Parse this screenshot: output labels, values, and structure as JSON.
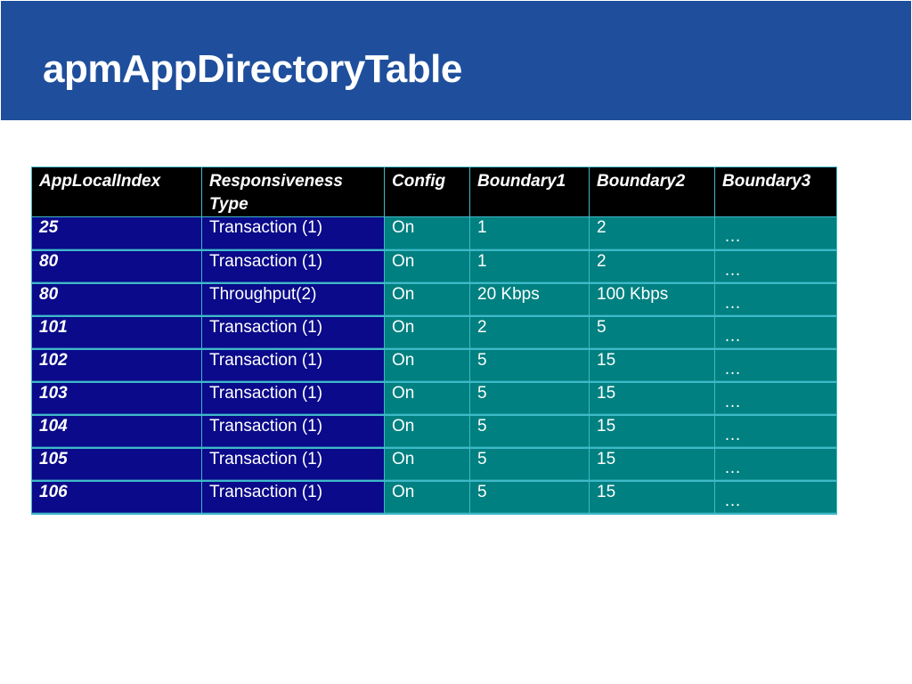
{
  "title": "apmAppDirectoryTable",
  "table": {
    "headers": [
      "AppLocalIndex",
      "Responsiveness Type",
      "Config",
      "Boundary1",
      "Boundary2",
      "Boundary3"
    ],
    "rows": [
      [
        "25",
        "Transaction (1)",
        "On",
        "1",
        "2",
        "…"
      ],
      [
        "80",
        "Transaction (1)",
        "On",
        "1",
        "2",
        "…"
      ],
      [
        "80",
        "Throughput(2)",
        "On",
        "20 Kbps",
        "100 Kbps",
        "…"
      ],
      [
        "101",
        "Transaction (1)",
        "On",
        "2",
        "5",
        "…"
      ],
      [
        "102",
        "Transaction (1)",
        "On",
        "5",
        "15",
        "…"
      ],
      [
        "103",
        "Transaction (1)",
        "On",
        "5",
        "15",
        "…"
      ],
      [
        "104",
        "Transaction (1)",
        "On",
        "5",
        "15",
        "…"
      ],
      [
        "105",
        "Transaction (1)",
        "On",
        "5",
        "15",
        "…"
      ],
      [
        "106",
        "Transaction (1)",
        "On",
        "5",
        "15",
        "…"
      ]
    ]
  },
  "colors": {
    "title_bar": "#1f4f9c",
    "header_bg": "#000000",
    "index_bg": "#0a0a8a",
    "body_bg": "#008080",
    "grid": "#3fb9c9"
  }
}
